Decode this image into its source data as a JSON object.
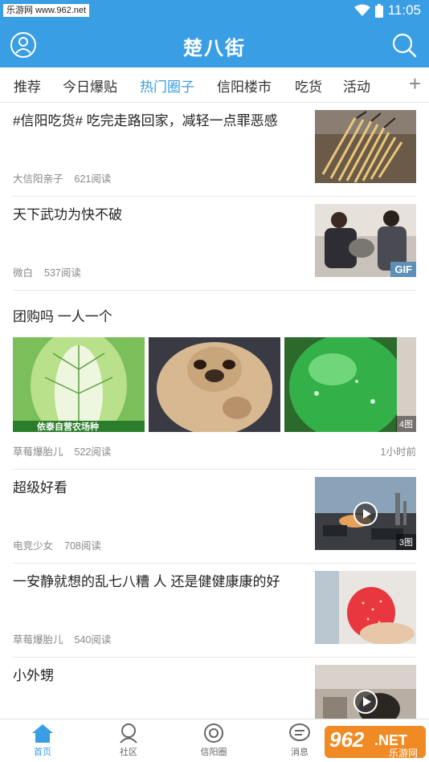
{
  "watermark": "乐游网 www.962.net",
  "status": {
    "time": "11:05"
  },
  "appbar": {
    "title": "楚八街"
  },
  "tabs": [
    "推荐",
    "今日爆贴",
    "热门圈子",
    "信阳楼市",
    "吃货",
    "活动"
  ],
  "tab_add": "+",
  "feed": [
    {
      "title": "#信阳吃货# 吃完走路回家，减轻一点罪恶感",
      "author": "大信阳亲子",
      "reads": "621阅读"
    },
    {
      "title": "天下武功为快不破",
      "author": "微白",
      "reads": "537阅读",
      "badge": "GIF"
    },
    {
      "title": "团购吗 一人一个",
      "author": "草莓爆胎儿",
      "reads": "522阅读",
      "time": "1小时前",
      "badge": "4图",
      "img_text": "依泰自营农场种"
    },
    {
      "title": "超级好看",
      "author": "电竞少女",
      "reads": "708阅读",
      "badge": "3图"
    },
    {
      "title": "一安静就想的乱七八糟 人 还是健健康康的好",
      "author": "草莓爆胎儿",
      "reads": "540阅读"
    },
    {
      "title": "小外甥"
    }
  ],
  "nav": [
    "首页",
    "社区",
    "信阳圈",
    "消息"
  ],
  "brand": {
    "logo": "962",
    "logo_suffix": ".NET",
    "logo_sub": "乐游网"
  },
  "colors": {
    "accent": "#3a9ee4"
  }
}
